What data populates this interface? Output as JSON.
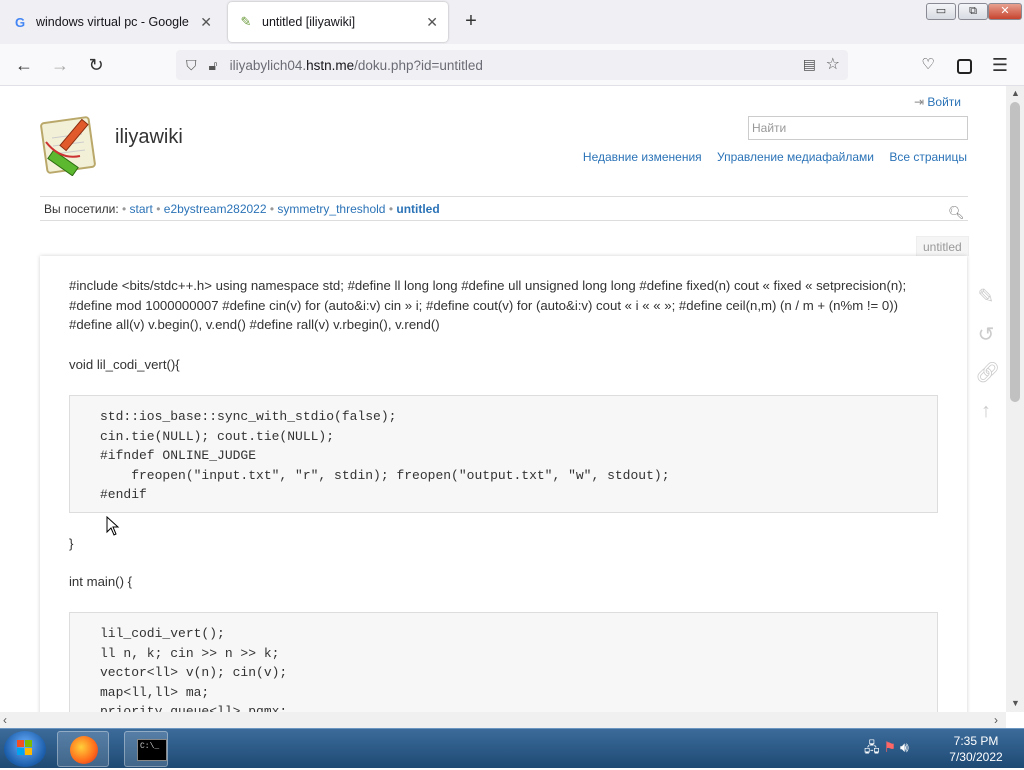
{
  "browser": {
    "tabs": [
      {
        "title": "windows virtual pc - Google Se",
        "favicon": "google-g-icon",
        "active": false
      },
      {
        "title": "untitled [iliyawiki]",
        "favicon": "dokuwiki-icon",
        "active": true
      }
    ],
    "window_controls": {
      "minimize": "▭",
      "maximize": "⧉",
      "close": "✕"
    },
    "url": {
      "prefix": "iliyabylich04.",
      "host": "hstn.me",
      "path": "/doku.php?id=untitled"
    }
  },
  "site": {
    "title": "iliyawiki",
    "login_label": "Войти",
    "search_placeholder": "Найти",
    "nav": [
      "Недавние изменения",
      "Управление медиафайлами",
      "Все страницы"
    ],
    "trace_label": "Вы посетили:",
    "trace": [
      "start",
      "e2bystream282022",
      "symmetry_threshold",
      "untitled"
    ],
    "pagename": "untitled"
  },
  "content": {
    "para1": "#include <bits/stdc++.h> using namespace std; #define ll long long #define ull unsigned long long #define fixed(n) cout « fixed « setprecision(n); #define mod 1000000007 #define cin(v) for (auto&i:v) cin » i; #define cout(v) for (auto&i:v) cout « i « « »; #define ceil(n,m) (n / m + (n%m != 0)) #define all(v) v.begin(), v.end() #define rall(v) v.rbegin(), v.rend()",
    "func_decl": "void lil_codi_vert(){",
    "code1": "std::ios_base::sync_with_stdio(false);\ncin.tie(NULL); cout.tie(NULL);\n#ifndef ONLINE_JUDGE\n    freopen(\"input.txt\", \"r\", stdin); freopen(\"output.txt\", \"w\", stdout);\n#endif",
    "close_brace": "}",
    "main_decl": "int main() {",
    "code2": "lil_codi_vert();\nll n, k; cin >> n >> k;\nvector<ll> v(n); cin(v);\nmap<ll,ll> ma;\npriority_queue<ll> pqmx;"
  },
  "taskbar": {
    "clock_time": "7:35 PM",
    "clock_date": "7/30/2022"
  }
}
